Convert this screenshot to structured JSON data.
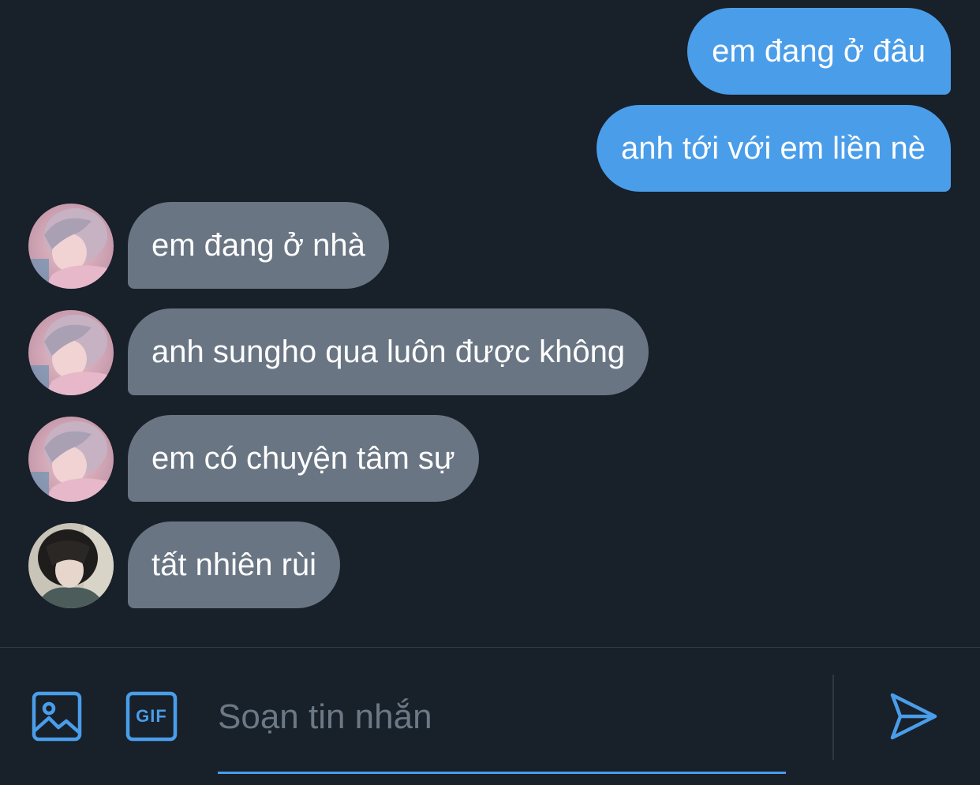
{
  "messages": [
    {
      "direction": "out",
      "text": "em đang ở đâu"
    },
    {
      "direction": "out",
      "text": "anh tới với em liền nè"
    },
    {
      "direction": "in",
      "avatar": "avatar-pink-hair",
      "text": "em đang ở nhà"
    },
    {
      "direction": "in",
      "avatar": "avatar-pink-hair",
      "text": "anh sungho qua luôn được không"
    },
    {
      "direction": "in",
      "avatar": "avatar-pink-hair",
      "text": "em có chuyện tâm sự"
    },
    {
      "direction": "in",
      "avatar": "avatar-dark-hair",
      "text": "tất nhiên rùi"
    }
  ],
  "composer": {
    "placeholder": "Soạn tin nhắn",
    "gif_label": "GIF",
    "icons": [
      "image-icon",
      "gif-icon",
      "send-icon"
    ]
  },
  "colors": {
    "background": "#18202a",
    "outgoing_bubble": "#4a9de9",
    "incoming_bubble": "#697583",
    "accent": "#4a9de9",
    "placeholder": "#6c7886"
  }
}
